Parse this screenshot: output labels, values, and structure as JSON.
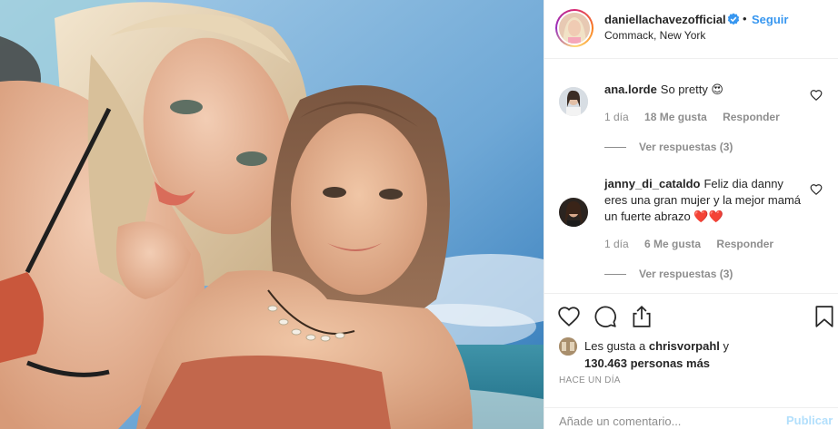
{
  "post": {
    "username": "daniellachavezofficial",
    "separator": "•",
    "follow_label": "Seguir",
    "location": "Commack, New York",
    "icons": {
      "verified": "verified-badge-icon",
      "like": "heart-icon",
      "comment": "comment-bubble-icon",
      "share": "share-icon",
      "save": "bookmark-icon"
    },
    "colors": {
      "link_blue": "#3897f0",
      "text": "#262626",
      "muted": "#8e8e8e",
      "post_disabled": "#b2dffc"
    }
  },
  "comments": [
    {
      "user": "ana.lorde",
      "text": "So pretty 😍",
      "age": "1 día",
      "likes": "18 Me gusta",
      "reply_label": "Responder",
      "view_replies": "Ver respuestas (3)"
    },
    {
      "user": "janny_di_cataldo",
      "text": "Feliz dia danny eres una gran mujer y la mejor mamá un fuerte abrazo ❤️❤️",
      "age": "1 día",
      "likes": "6 Me gusta",
      "reply_label": "Responder",
      "view_replies": "Ver respuestas (3)"
    }
  ],
  "likes": {
    "prefix": "Les gusta a",
    "user": "chrisvorpahl",
    "conjunction": "y",
    "count": "130.463 personas más"
  },
  "timestamp": "HACE UN DÍA",
  "add_comment": {
    "placeholder": "Añade un comentario...",
    "post_label": "Publicar"
  }
}
